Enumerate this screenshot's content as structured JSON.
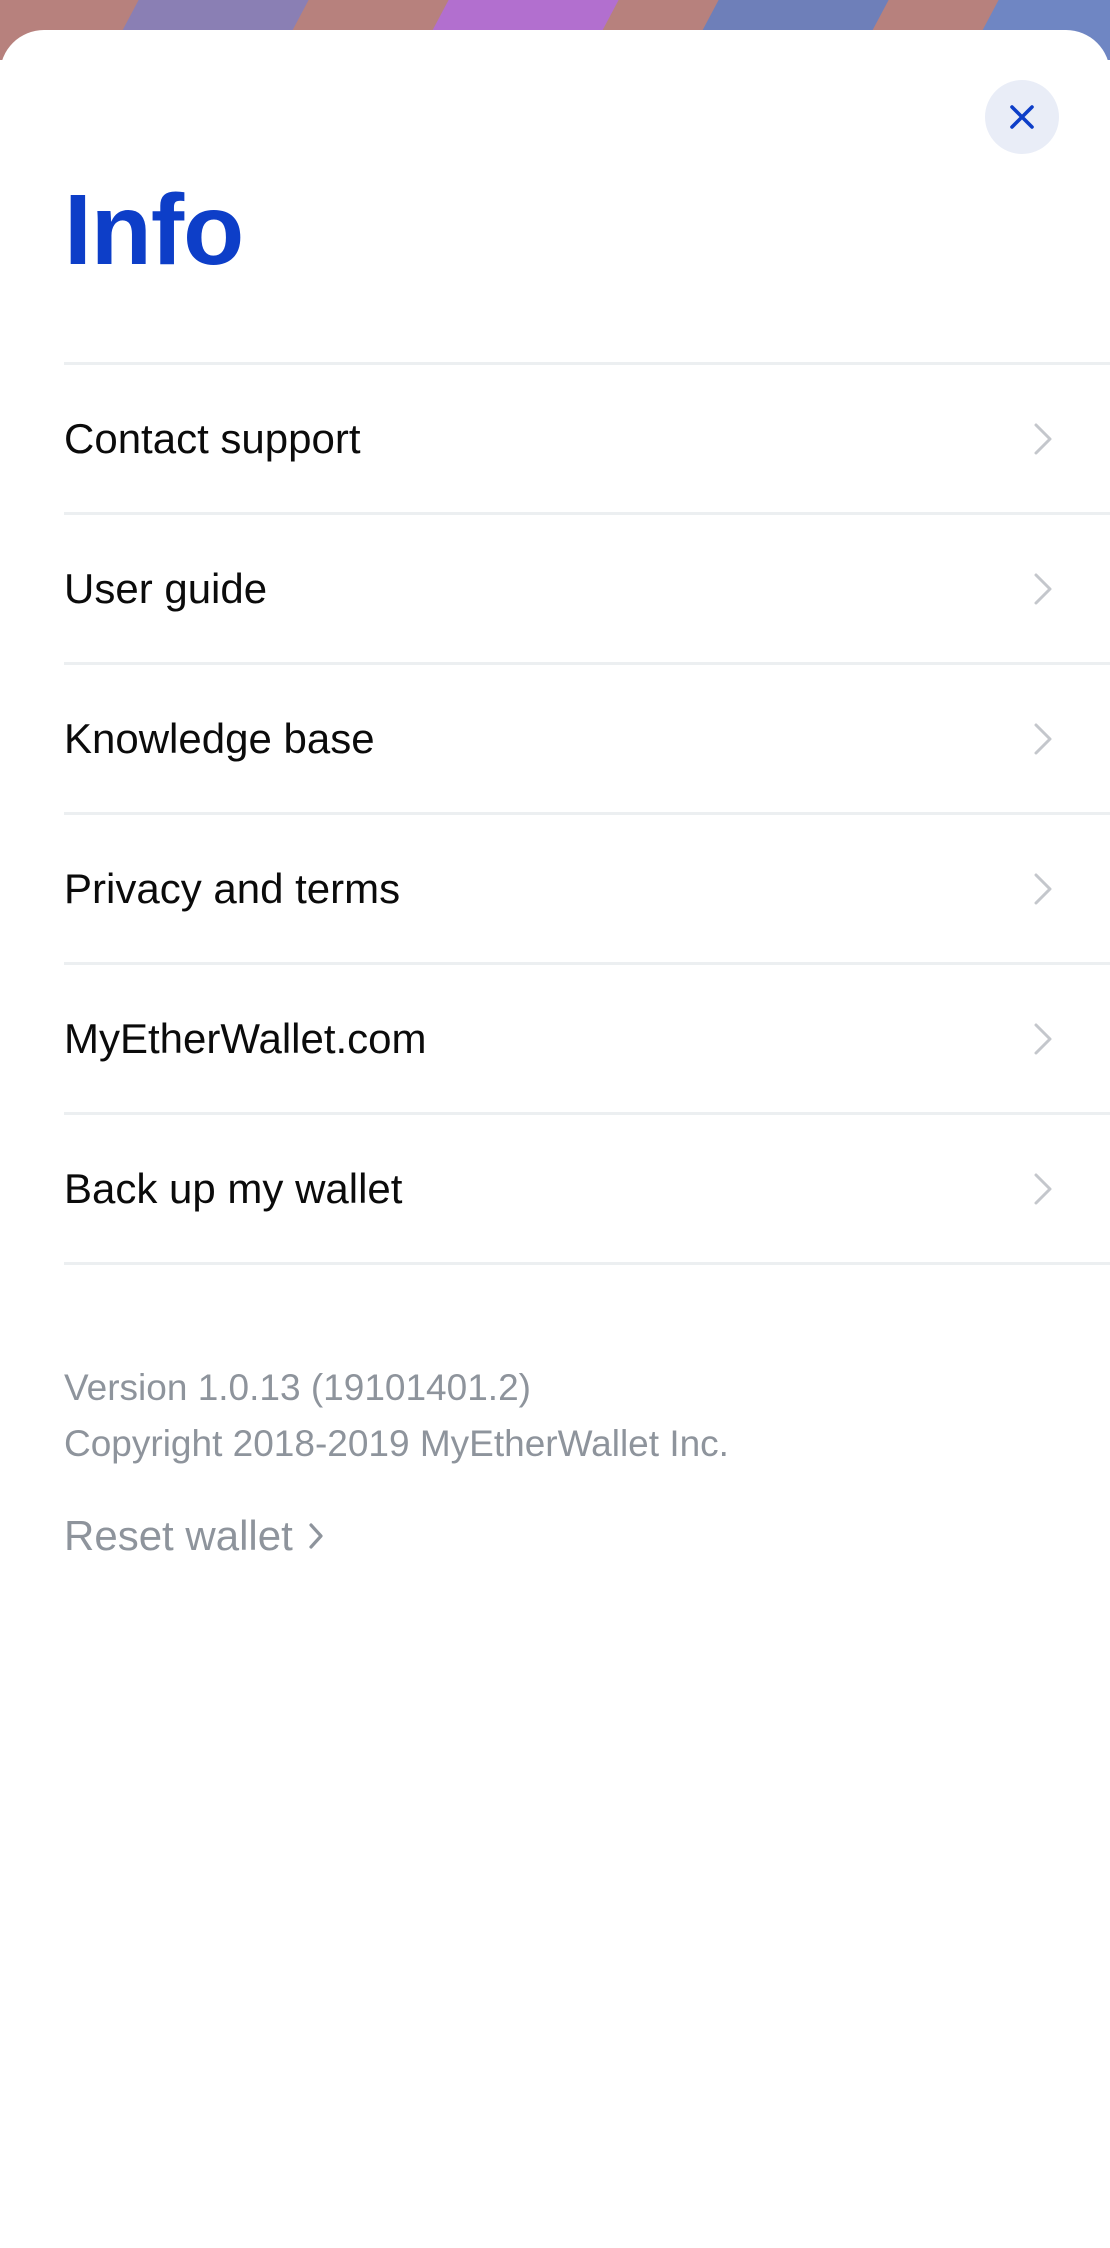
{
  "screen": {
    "title": "Info",
    "close_icon": "close-icon",
    "accent_color": "#0d3ec8"
  },
  "menu": {
    "items": [
      {
        "label": "Contact support",
        "icon": "chevron-right-icon"
      },
      {
        "label": "User guide",
        "icon": "chevron-right-icon"
      },
      {
        "label": "Knowledge base",
        "icon": "chevron-right-icon"
      },
      {
        "label": "Privacy and terms",
        "icon": "chevron-right-icon"
      },
      {
        "label": "MyEtherWallet.com",
        "icon": "chevron-right-icon"
      },
      {
        "label": "Back up my wallet",
        "icon": "chevron-right-icon"
      }
    ]
  },
  "footer": {
    "version": "Version 1.0.13 (19101401.2)",
    "copyright": "Copyright 2018-2019 MyEtherWallet Inc.",
    "reset_label": "Reset wallet",
    "reset_icon": "chevron-right-icon"
  }
}
